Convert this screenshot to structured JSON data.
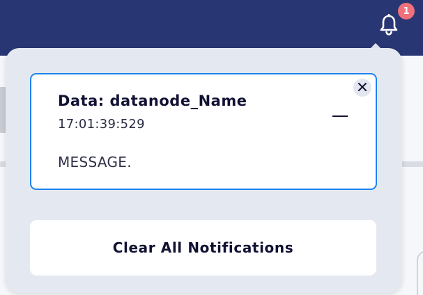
{
  "header": {
    "background_color": "#283673",
    "bell_icon": "bell-icon",
    "badge_count": "1",
    "badge_color": "#f0707b"
  },
  "notifications_panel": {
    "background_color": "#e4e8f1",
    "items": [
      {
        "title": "Data: datanode_Name",
        "timestamp": "17:01:39:529",
        "message": "MESSAGE.",
        "border_color": "#1a82f0",
        "close_icon": "close-icon",
        "minimize_icon": "minimize-icon"
      }
    ],
    "clear_all_label": "Clear All Notifications"
  }
}
